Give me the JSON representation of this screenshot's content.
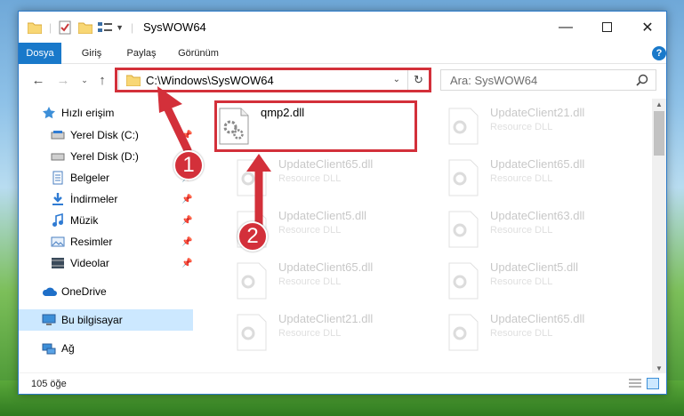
{
  "window": {
    "title": "SysWOW64"
  },
  "ribbon": {
    "tabs": [
      {
        "label": "Dosya",
        "active": true
      },
      {
        "label": "Giriş",
        "active": false
      },
      {
        "label": "Paylaş",
        "active": false
      },
      {
        "label": "Görünüm",
        "active": false
      }
    ]
  },
  "address": {
    "path": "C:\\Windows\\SysWOW64"
  },
  "search": {
    "placeholder": "Ara: SysWOW64"
  },
  "sidebar": {
    "items": [
      {
        "label": "Hızlı erişim",
        "icon": "star-icon"
      },
      {
        "label": "Yerel Disk (C:)",
        "icon": "drive-icon",
        "pinned": true
      },
      {
        "label": "Yerel Disk (D:)",
        "icon": "drive-icon",
        "pinned": true
      },
      {
        "label": "Belgeler",
        "icon": "documents-icon",
        "pinned": true
      },
      {
        "label": "İndirmeler",
        "icon": "download-icon",
        "pinned": true
      },
      {
        "label": "Müzik",
        "icon": "music-icon",
        "pinned": true
      },
      {
        "label": "Resimler",
        "icon": "pictures-icon",
        "pinned": true
      },
      {
        "label": "Videolar",
        "icon": "videos-icon",
        "pinned": true
      },
      {
        "label": "OneDrive",
        "icon": "cloud-icon"
      },
      {
        "label": "Bu bilgisayar",
        "icon": "computer-icon",
        "selected": true
      },
      {
        "label": "Ağ",
        "icon": "network-icon"
      }
    ]
  },
  "files": [
    {
      "name": "qmp2.dll",
      "type": "",
      "highlighted": true
    },
    {
      "name": "UpdateClient21.dll",
      "type": "Resource DLL"
    },
    {
      "name": "UpdateClient65.dll",
      "type": "Resource DLL"
    },
    {
      "name": "UpdateClient65.dll",
      "type": "Resource DLL"
    },
    {
      "name": "UpdateClient5.dll",
      "type": "Resource DLL"
    },
    {
      "name": "UpdateClient63.dll",
      "type": "Resource DLL"
    },
    {
      "name": "UpdateClient65.dll",
      "type": "Resource DLL"
    },
    {
      "name": "UpdateClient5.dll",
      "type": "Resource DLL"
    },
    {
      "name": "UpdateClient21.dll",
      "type": "Resource DLL"
    },
    {
      "name": "UpdateClient65.dll",
      "type": "Resource DLL"
    }
  ],
  "status": {
    "count": "105 öğe"
  },
  "annotations": [
    {
      "label": "1"
    },
    {
      "label": "2"
    }
  ],
  "colors": {
    "accent": "#1979ca",
    "highlight": "#d3303a",
    "selected": "#cce8ff"
  }
}
